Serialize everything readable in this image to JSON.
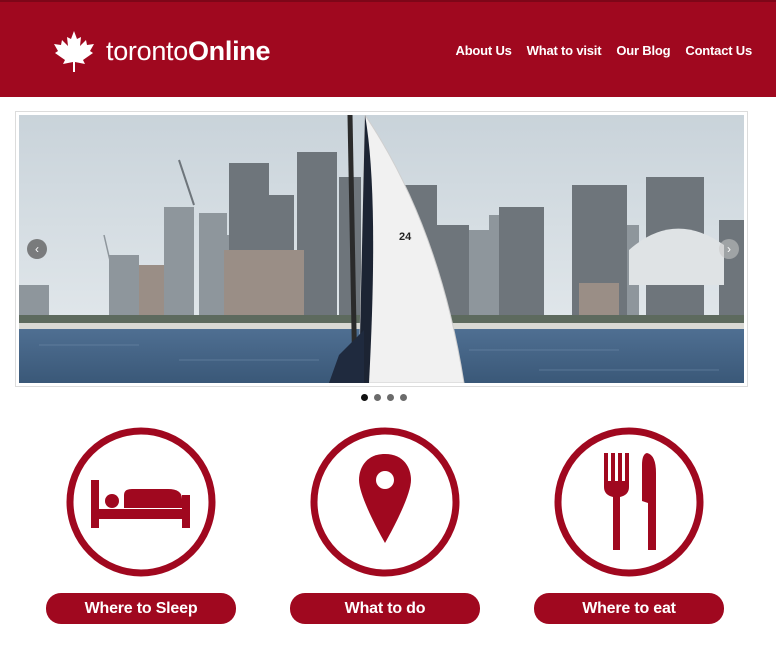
{
  "brand": {
    "logo_icon": "maple-leaf-icon",
    "name_light": "toronto",
    "name_bold": "Online",
    "color": "#a0081f"
  },
  "nav": {
    "items": [
      {
        "label": "About Us"
      },
      {
        "label": "What to visit"
      },
      {
        "label": "Our Blog"
      },
      {
        "label": "Contact Us"
      }
    ]
  },
  "carousel": {
    "slide_description_icon": "toronto-skyline-photo",
    "prev_icon": "chevron-left-icon",
    "next_icon": "chevron-right-icon",
    "prev_glyph": "‹",
    "next_glyph": "›",
    "total_slides": 4,
    "active_slide": 1
  },
  "features": [
    {
      "icon": "bed-icon",
      "label": "Where to Sleep"
    },
    {
      "icon": "map-pin-icon",
      "label": "What to do"
    },
    {
      "icon": "fork-knife-icon",
      "label": "Where to eat"
    }
  ]
}
